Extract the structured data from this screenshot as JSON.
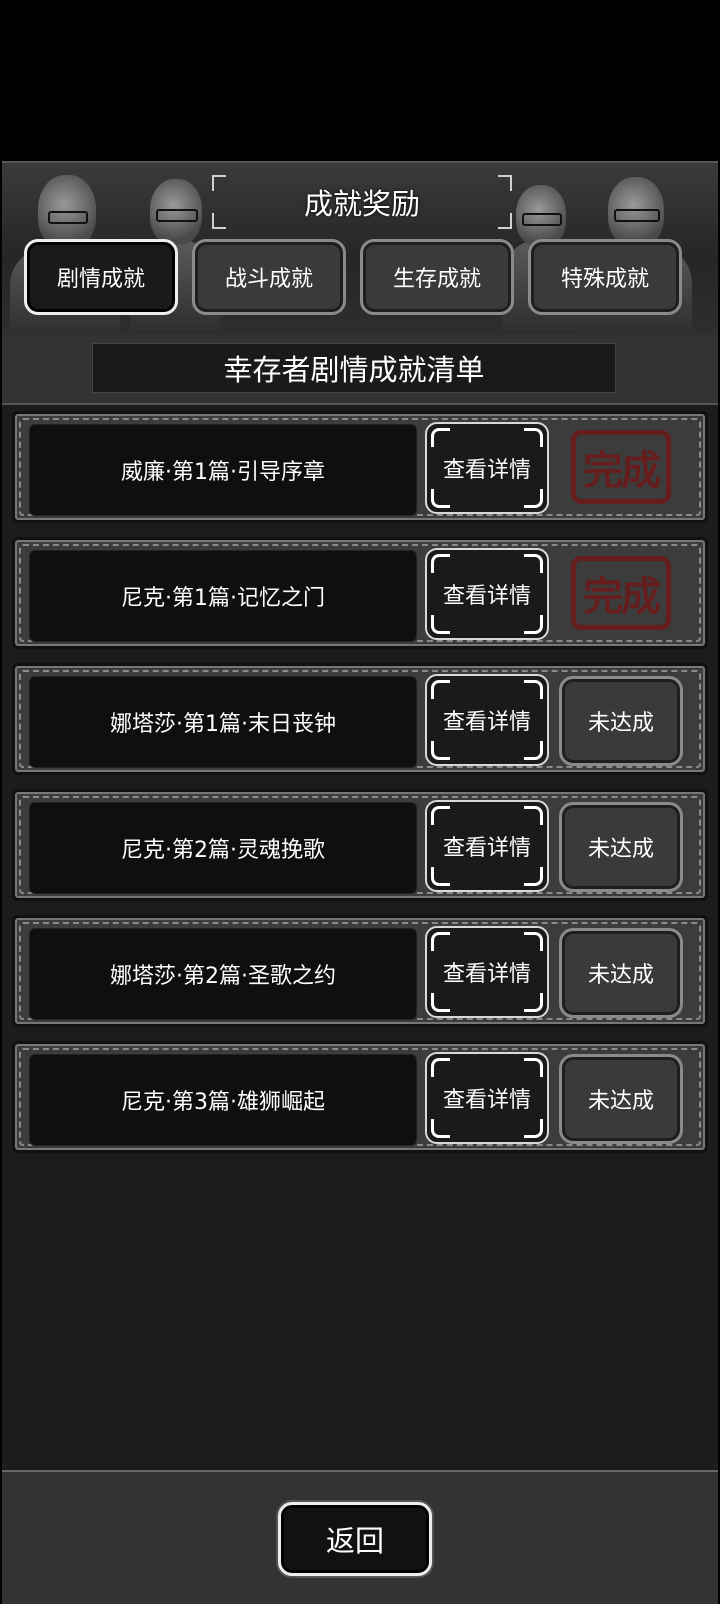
{
  "header": {
    "title": "成就奖励",
    "tabs": [
      {
        "label": "剧情成就",
        "active": true
      },
      {
        "label": "战斗成就",
        "active": false
      },
      {
        "label": "生存成就",
        "active": false
      },
      {
        "label": "特殊成就",
        "active": false
      }
    ]
  },
  "list_title": "幸存者剧情成就清单",
  "detail_label": "查看详情",
  "status_incomplete_label": "未达成",
  "stamp_label": "完成",
  "items": [
    {
      "name": "威廉·第1篇·引导序章",
      "completed": true
    },
    {
      "name": "尼克·第1篇·记忆之门",
      "completed": true
    },
    {
      "name": "娜塔莎·第1篇·末日丧钟",
      "completed": false
    },
    {
      "name": "尼克·第2篇·灵魂挽歌",
      "completed": false
    },
    {
      "name": "娜塔莎·第2篇·圣歌之约",
      "completed": false
    },
    {
      "name": "尼克·第3篇·雄狮崛起",
      "completed": false
    }
  ],
  "back_label": "返回",
  "colors": {
    "stamp": "#6b1a1a",
    "panel": "#1c1c1c",
    "row": "#3c3c3c"
  }
}
